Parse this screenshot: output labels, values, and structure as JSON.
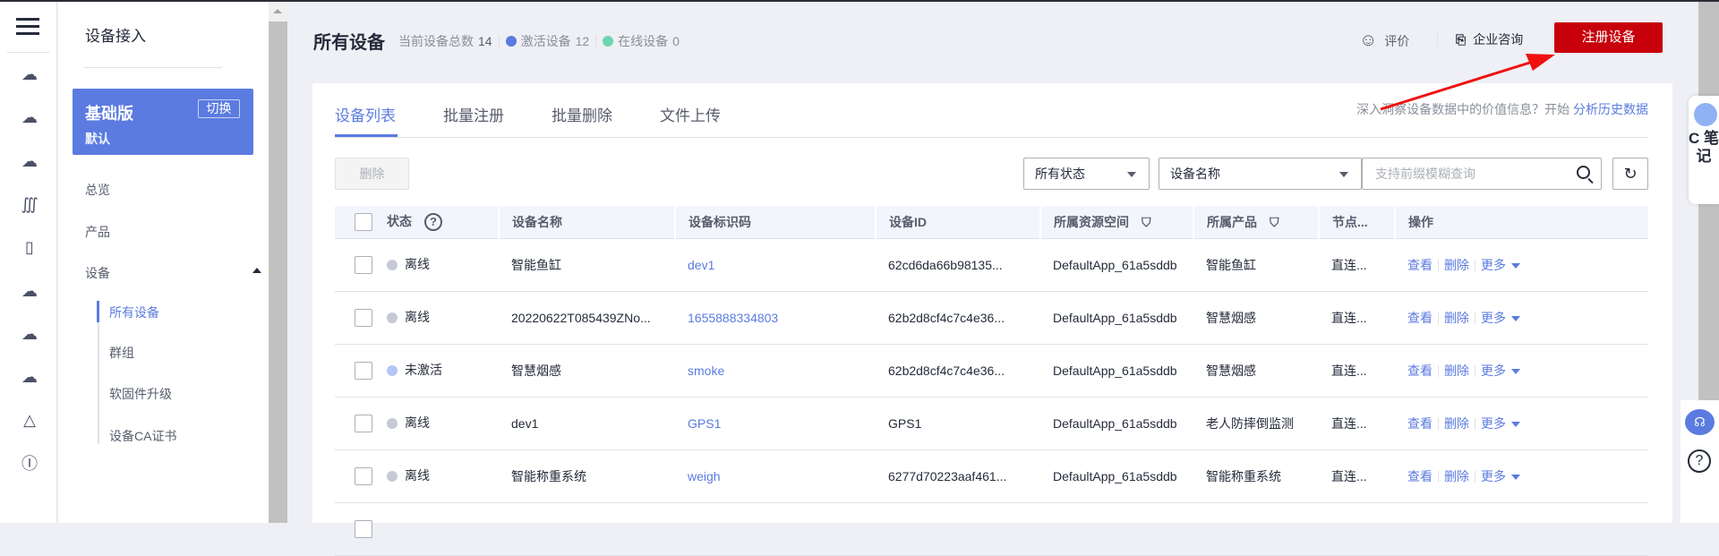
{
  "rail_icons": [
    "cloud-server-icon",
    "cloud-chat-icon",
    "cloud-device-icon",
    "wave-icon",
    "phone-cloud-icon",
    "clouds-icon",
    "cloud-upload-icon",
    "cloud-send-icon",
    "pyramid-icon",
    "ip-icon"
  ],
  "sidebar": {
    "title": "设备接入",
    "edition": {
      "name": "基础版",
      "switch_label": "切换",
      "instance": "默认"
    },
    "items": [
      {
        "label": "总览"
      },
      {
        "label": "产品"
      },
      {
        "label": "设备"
      }
    ],
    "sub_items": [
      {
        "label": "所有设备",
        "active": true
      },
      {
        "label": "群组"
      },
      {
        "label": "软固件升级"
      },
      {
        "label": "设备CA证书"
      }
    ]
  },
  "header": {
    "title": "所有设备",
    "total_label": "当前设备总数",
    "total": "14",
    "active_label": "激活设备",
    "active": "12",
    "online_label": "在线设备",
    "online": "0",
    "rate_label": "评价",
    "consult_label": "企业咨询",
    "register_label": "注册设备"
  },
  "colors": {
    "accent": "#5b7be0",
    "register": "#c7000b",
    "active_dot": "#5b7be0",
    "online_dot": "#6dd5b0",
    "offline_dot": "#c6cad4",
    "inactive_dot": "#b4c6f7"
  },
  "tabs": [
    {
      "label": "设备列表",
      "active": true
    },
    {
      "label": "批量注册"
    },
    {
      "label": "批量删除"
    },
    {
      "label": "文件上传"
    }
  ],
  "insight": {
    "text": "深入洞察设备数据中的价值信息？开始",
    "link": "分析历史数据"
  },
  "toolbar": {
    "delete_label": "删除",
    "status_select": "所有状态",
    "field_select": "设备名称",
    "search_placeholder": "支持前缀模糊查询"
  },
  "table": {
    "columns": [
      "状态",
      "设备名称",
      "设备标识码",
      "设备ID",
      "所属资源空间",
      "所属产品",
      "节点...",
      "操作"
    ],
    "rows": [
      {
        "status": "离线",
        "dot": "offline",
        "name": "智能鱼缸",
        "node_id": "dev1",
        "device_id": "62cd6da66b98135...",
        "space": "DefaultApp_61a5sddb",
        "product": "智能鱼缸",
        "node": "直连..."
      },
      {
        "status": "离线",
        "dot": "offline",
        "name": "20220622T085439ZNo...",
        "node_id": "1655888334803",
        "device_id": "62b2d8cf4c7c4e36...",
        "space": "DefaultApp_61a5sddb",
        "product": "智慧烟感",
        "node": "直连..."
      },
      {
        "status": "未激活",
        "dot": "inactive",
        "name": "智慧烟感",
        "node_id": "smoke",
        "device_id": "62b2d8cf4c7c4e36...",
        "space": "DefaultApp_61a5sddb",
        "product": "智慧烟感",
        "node": "直连..."
      },
      {
        "status": "离线",
        "dot": "offline",
        "name": "dev1",
        "node_id": "GPS1",
        "device_id": "GPS1",
        "space": "DefaultApp_61a5sddb",
        "product": "老人防摔倒监测",
        "node": "直连..."
      },
      {
        "status": "离线",
        "dot": "offline",
        "name": "智能称重系统",
        "node_id": "weigh",
        "device_id": "6277d70223aaf461...",
        "space": "DefaultApp_61a5sddb",
        "product": "智能称重系统",
        "node": "直连..."
      }
    ],
    "actions": {
      "view": "查看",
      "delete": "删除",
      "more": "更多"
    }
  },
  "float": {
    "note_label": "C 笔记"
  }
}
